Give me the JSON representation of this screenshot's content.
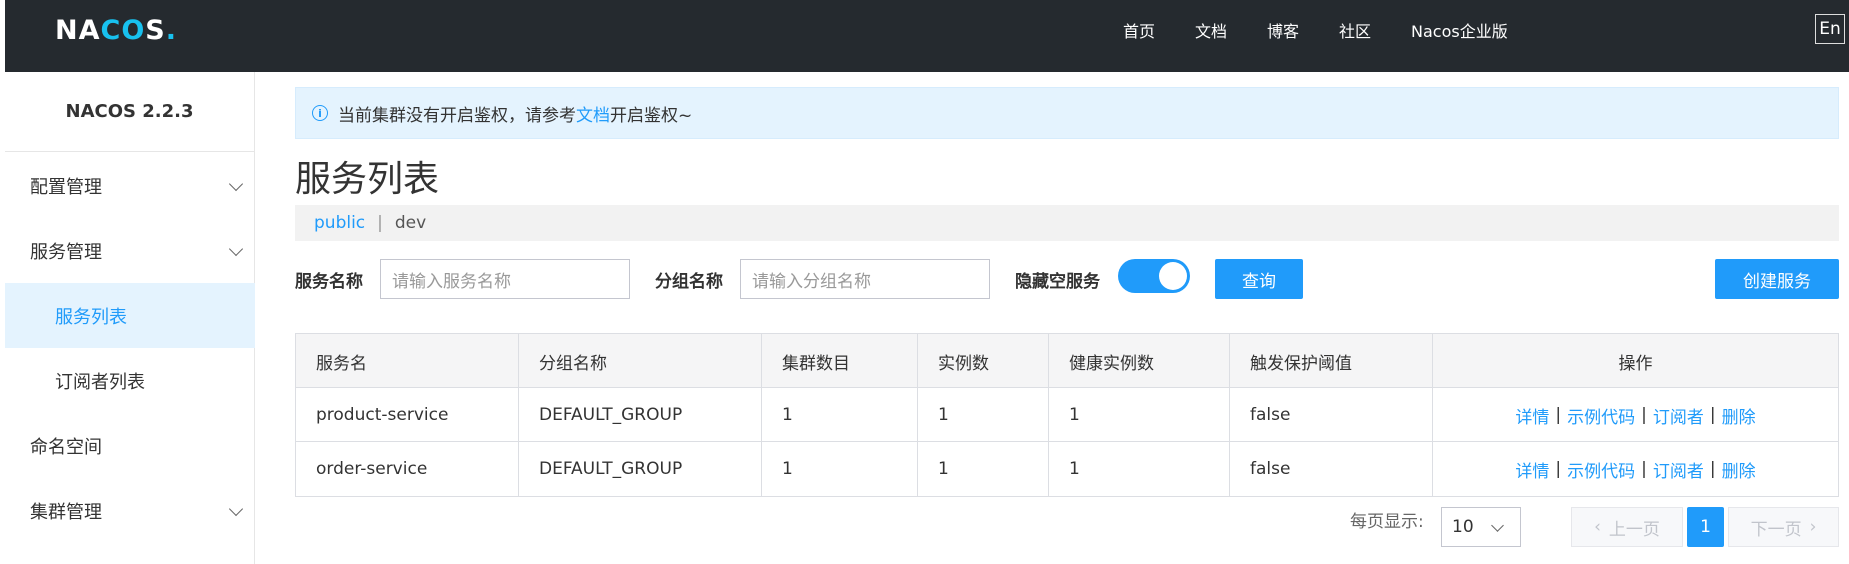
{
  "header": {
    "logo": "NACOS.",
    "nav": [
      "首页",
      "文档",
      "博客",
      "社区",
      "Nacos企业版"
    ],
    "lang": "En"
  },
  "sidebar": {
    "version": "NACOS 2.2.3",
    "items": [
      {
        "label": "配置管理",
        "expandable": true
      },
      {
        "label": "服务管理",
        "expandable": true
      },
      {
        "label": "服务列表",
        "active": true
      },
      {
        "label": "订阅者列表"
      },
      {
        "label": "命名空间"
      },
      {
        "label": "集群管理",
        "expandable": true
      }
    ]
  },
  "alert": {
    "icon": "info-icon",
    "text_before": "当前集群没有开启鉴权，请参考",
    "link": "文档",
    "text_after": "开启鉴权~"
  },
  "page": {
    "title": "服务列表"
  },
  "namespaces": {
    "active": "public",
    "separator": "|",
    "other": "dev"
  },
  "filters": {
    "service_name_label": "服务名称",
    "service_name_placeholder": "请输入服务名称",
    "group_name_label": "分组名称",
    "group_name_placeholder": "请输入分组名称",
    "hide_empty_label": "隐藏空服务",
    "hide_empty_on": true,
    "query_button": "查询",
    "create_button": "创建服务"
  },
  "table": {
    "headers": [
      "服务名",
      "分组名称",
      "集群数目",
      "实例数",
      "健康实例数",
      "触发保护阈值",
      "操作"
    ],
    "rows": [
      [
        "product-service",
        "DEFAULT_GROUP",
        "1",
        "1",
        "1",
        "false"
      ],
      [
        "order-service",
        "DEFAULT_GROUP",
        "1",
        "1",
        "1",
        "false"
      ]
    ],
    "actions": {
      "detail": "详情",
      "sample_code": "示例代码",
      "subscribers": "订阅者",
      "delete": "删除",
      "sep": "|"
    }
  },
  "pagination": {
    "per_page_label": "每页显示:",
    "page_size": "10",
    "prev": "上一页",
    "current": "1",
    "next": "下一页"
  },
  "colors": {
    "primary": "#209bfa",
    "topbar": "#252a2f",
    "alert_bg": "#e4f3fe"
  }
}
